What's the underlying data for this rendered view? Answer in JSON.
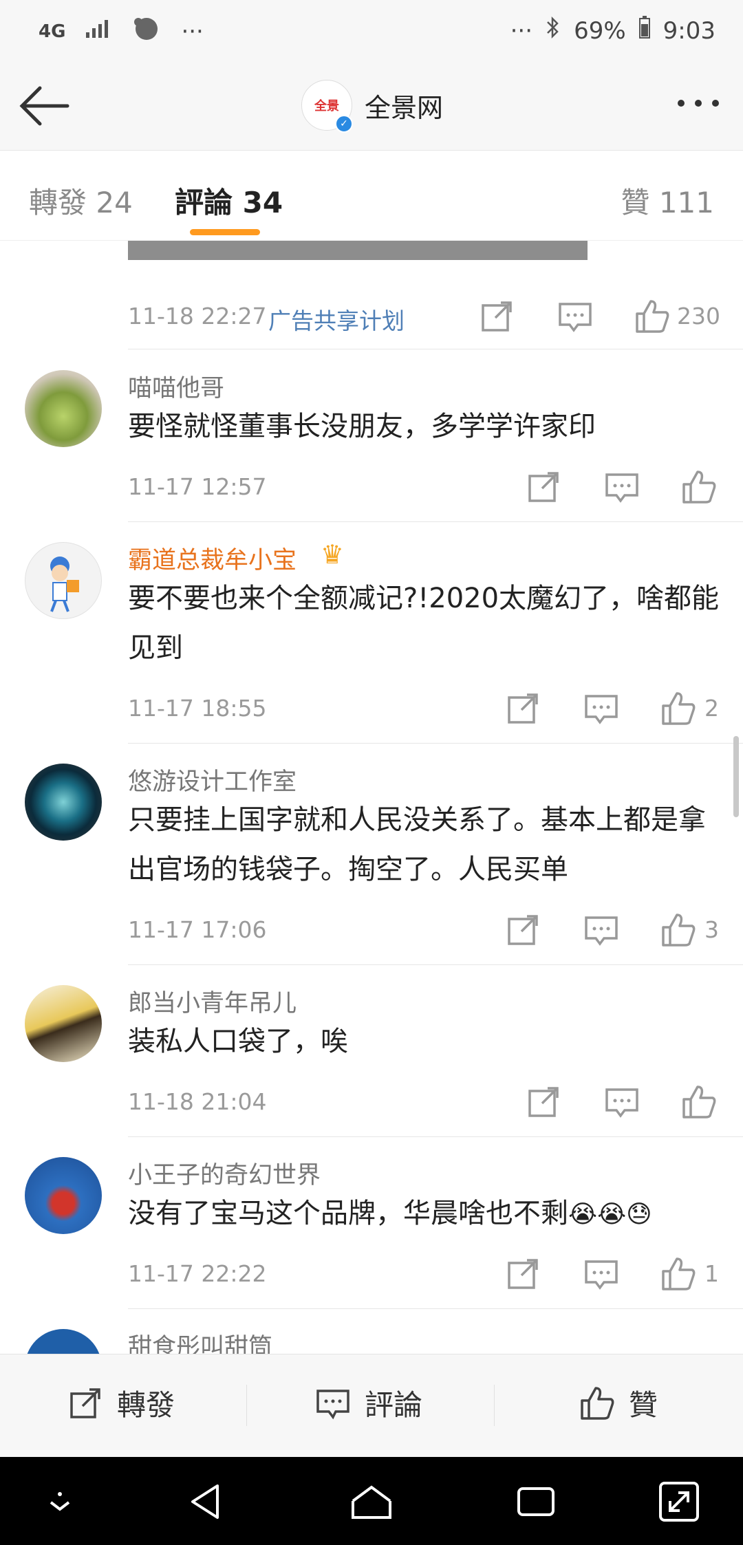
{
  "status_bar": {
    "network": "4G",
    "more_left": "···",
    "more_right": "···",
    "battery": "69%",
    "time": "9:03"
  },
  "header": {
    "title": "全景网",
    "logo_text": "全景"
  },
  "tabs": {
    "repost": "轉發 24",
    "comments": "評論 34",
    "likes": "贊 111"
  },
  "post_meta": {
    "time": "11-18 22:27",
    "source": "广告共享计划",
    "like_count": "230"
  },
  "comments": [
    {
      "name": "喵喵他哥",
      "content": "要怪就怪董事长没朋友，多学学许家印",
      "time": "11-17 12:57",
      "likes": ""
    },
    {
      "name": "霸道总裁牟小宝",
      "content": "要不要也来个全额减记?!2020太魔幻了，啥都能见到",
      "time": "11-17 18:55",
      "likes": "2"
    },
    {
      "name": "悠游设计工作室",
      "content": "只要挂上国字就和人民没关系了。基本上都是拿出官场的钱袋子。掏空了。人民买单",
      "time": "11-17 17:06",
      "likes": "3"
    },
    {
      "name": "郎当小青年吊儿",
      "content": "装私人口袋了，唉",
      "time": "11-18 21:04",
      "likes": ""
    },
    {
      "name": "小王子的奇幻世界",
      "content": "没有了宝马这个品牌，华晨啥也不剩",
      "emoji": "😭😭😓",
      "time": "11-17 22:22",
      "likes": "1"
    },
    {
      "name": "甜食彤叫甜筒",
      "content": "",
      "time": "",
      "likes": ""
    }
  ],
  "bottom_bar": {
    "repost": "轉發",
    "comment": "評論",
    "like": "贊"
  },
  "colors": {
    "accent": "#ff9a1f",
    "link": "#4f7fb6",
    "vip_name": "#e8731d"
  }
}
